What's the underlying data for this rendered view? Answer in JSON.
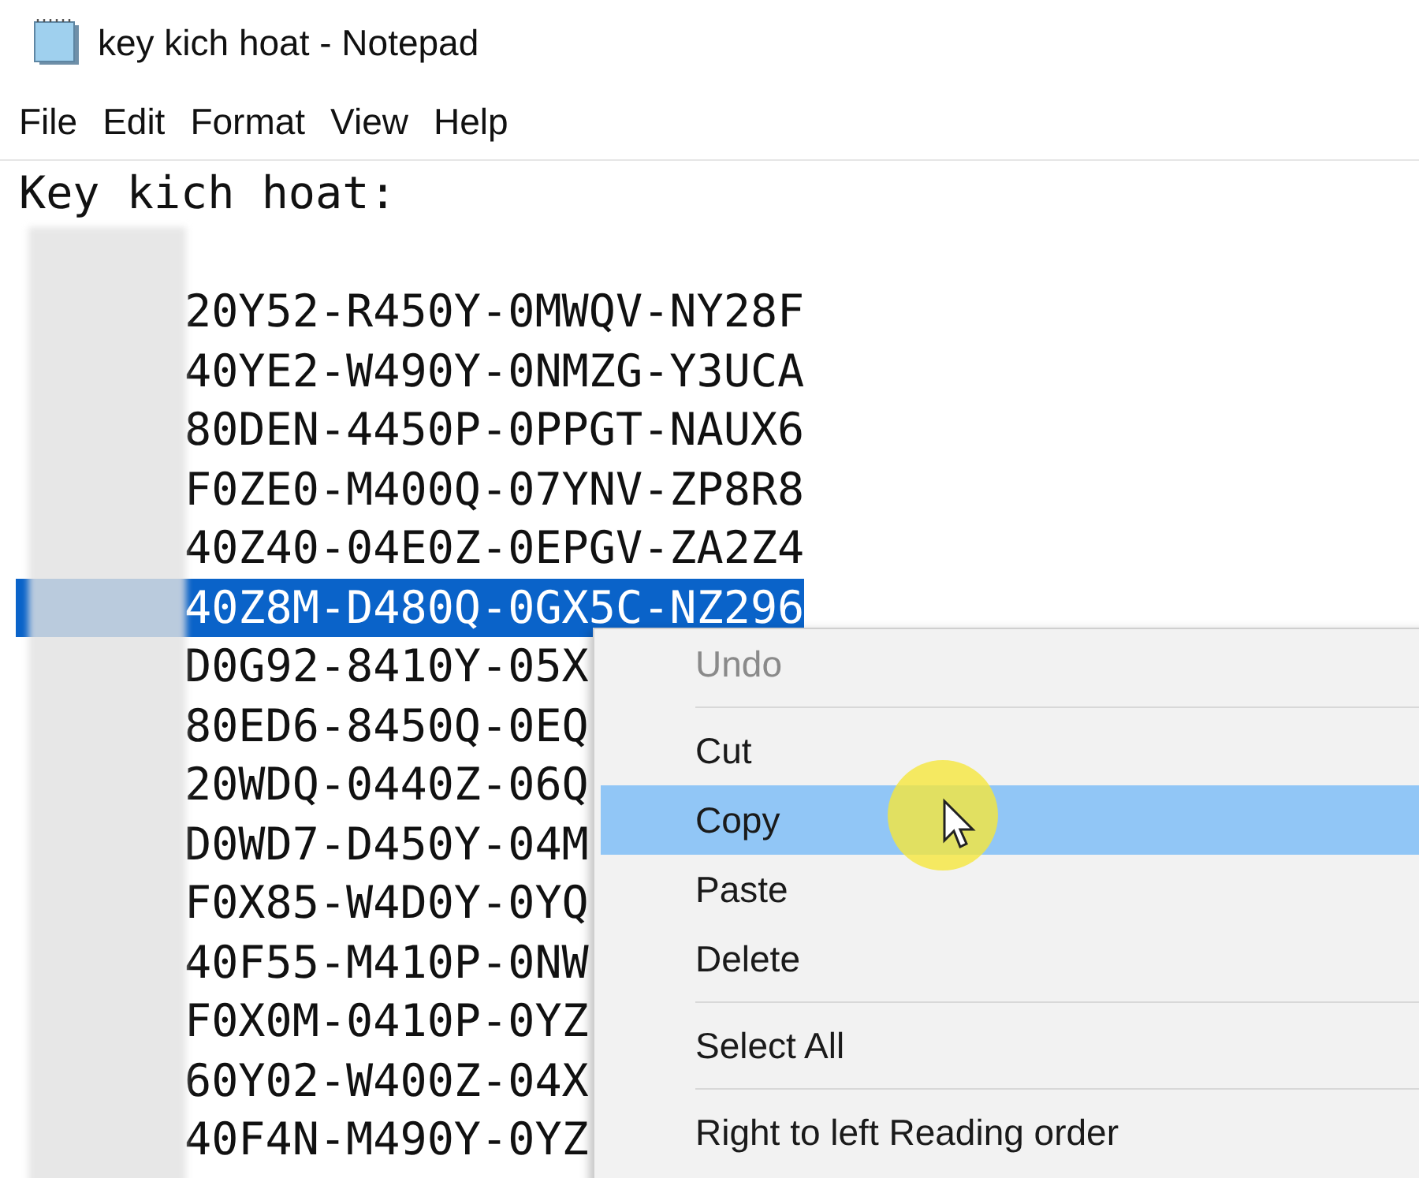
{
  "window": {
    "title": "key kich hoat - Notepad"
  },
  "menu_bar": [
    {
      "label": "File"
    },
    {
      "label": "Edit"
    },
    {
      "label": "Format"
    },
    {
      "label": "View"
    },
    {
      "label": "Help"
    }
  ],
  "editor": {
    "heading": "Key kich hoat:",
    "keys": [
      {
        "text": "20Y52-R450Y-0MWQV-NY28F",
        "selected": false
      },
      {
        "text": "40YE2-W490Y-0NMZG-Y3UCA",
        "selected": false
      },
      {
        "text": "80DEN-4450P-0PPGT-NAUX6",
        "selected": false
      },
      {
        "text": "F0ZE0-M400Q-07YNV-ZP8R8",
        "selected": false
      },
      {
        "text": "40Z40-04E0Z-0EPGV-ZA2Z4",
        "selected": false
      },
      {
        "text": "40Z8M-D480Q-0GX5C-NZ296",
        "selected": true
      },
      {
        "text": "D0G92-8410Y-05X",
        "selected": false
      },
      {
        "text": "80ED6-8450Q-0EQ",
        "selected": false
      },
      {
        "text": "20WDQ-0440Z-06Q",
        "selected": false
      },
      {
        "text": "D0WD7-D450Y-04M",
        "selected": false
      },
      {
        "text": "F0X85-W4D0Y-0YQ",
        "selected": false
      },
      {
        "text": "40F55-M410P-0NW",
        "selected": false
      },
      {
        "text": "F0X0M-0410P-0YZ",
        "selected": false
      },
      {
        "text": "60Y02-W400Z-04X",
        "selected": false
      },
      {
        "text": "40F4N-M490Y-0YZ",
        "selected": false
      }
    ]
  },
  "context_menu": {
    "items": [
      {
        "kind": "item",
        "label": "Undo",
        "disabled": true,
        "selected": false
      },
      {
        "kind": "separator"
      },
      {
        "kind": "item",
        "label": "Cut",
        "disabled": false,
        "selected": false
      },
      {
        "kind": "item",
        "label": "Copy",
        "disabled": false,
        "selected": true
      },
      {
        "kind": "item",
        "label": "Paste",
        "disabled": false,
        "selected": false
      },
      {
        "kind": "item",
        "label": "Delete",
        "disabled": false,
        "selected": false
      },
      {
        "kind": "separator"
      },
      {
        "kind": "item",
        "label": "Select All",
        "disabled": false,
        "selected": false
      },
      {
        "kind": "separator"
      },
      {
        "kind": "item",
        "label": "Right to left Reading order",
        "disabled": false,
        "selected": false
      }
    ]
  }
}
